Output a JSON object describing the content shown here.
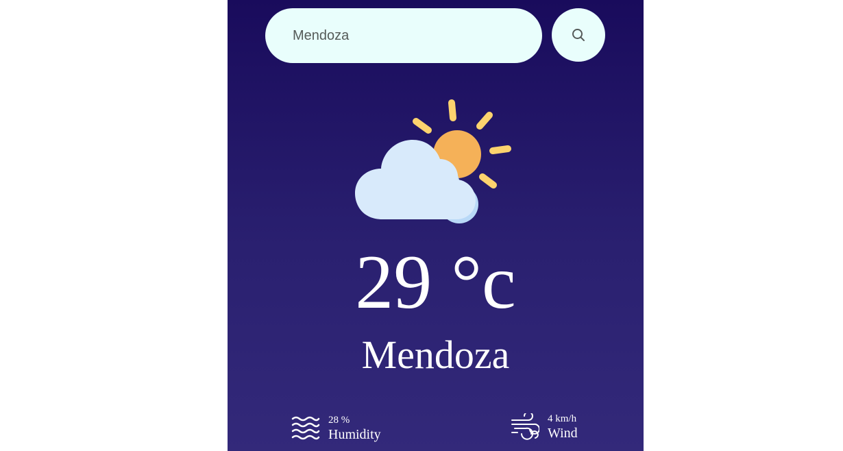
{
  "search": {
    "value": "Mendoza",
    "button_icon": "search-icon"
  },
  "weather": {
    "icon": "partly-cloudy-icon",
    "temperature": "29 °c",
    "city": "Mendoza"
  },
  "humidity": {
    "icon": "humidity-waves-icon",
    "value": "28 %",
    "label": "Humidity"
  },
  "wind": {
    "icon": "wind-icon",
    "value": "4 km/h",
    "label": "Wind"
  },
  "colors": {
    "background_top": "#190b5c",
    "background_bottom": "#33297a",
    "search_bg": "#e9fefc",
    "sun": "#f5b158",
    "sun_rays": "#fdd36e",
    "cloud": "#d8eafb",
    "text": "#ffffff"
  }
}
